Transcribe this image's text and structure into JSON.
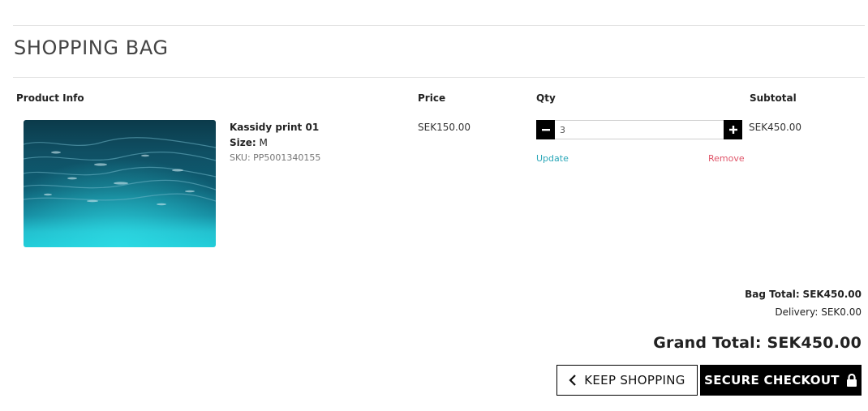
{
  "page": {
    "title": "SHOPPING BAG"
  },
  "table": {
    "headers": {
      "product_info": "Product Info",
      "price": "Price",
      "qty": "Qty",
      "subtotal": "Subtotal"
    }
  },
  "item": {
    "name": "Kassidy print 01",
    "size_label": "Size:",
    "size_value": "M",
    "sku": "SKU: PP5001340155",
    "price": "SEK150.00",
    "qty": "3",
    "subtotal": "SEK450.00",
    "update_label": "Update",
    "remove_label": "Remove",
    "image_icon": "ocean-underwater-photo"
  },
  "totals": {
    "bag_total_label": "Bag Total:",
    "bag_total_value": "SEK450.00",
    "delivery_label": "Delivery:",
    "delivery_value": "SEK0.00",
    "grand_total_label": "Grand Total:",
    "grand_total_value": "SEK450.00"
  },
  "actions": {
    "keep_shopping": "KEEP SHOPPING",
    "secure_checkout": "SECURE CHECKOUT"
  },
  "icons": {
    "minus": "minus-icon",
    "plus": "plus-icon",
    "back": "chevron-left-icon",
    "lock": "lock-icon"
  },
  "colors": {
    "update_link": "#2aa7b8",
    "remove_link": "#e0566a",
    "primary_button": "#000000"
  }
}
